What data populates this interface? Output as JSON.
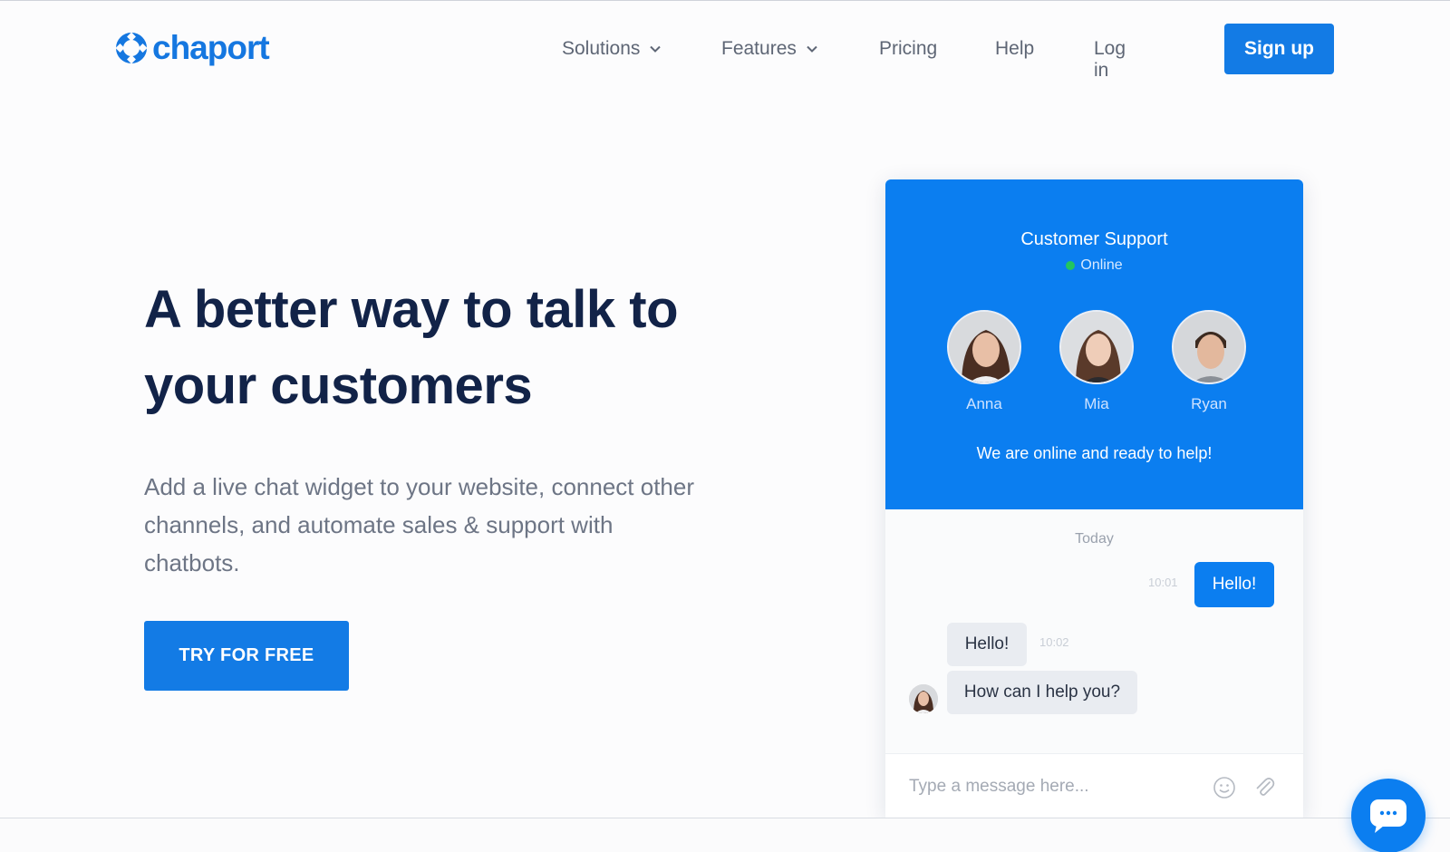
{
  "header": {
    "logo_text": "chaport",
    "nav": {
      "solutions": "Solutions",
      "features": "Features",
      "pricing": "Pricing",
      "help": "Help",
      "login": "Log in"
    },
    "signup_label": "Sign up"
  },
  "hero": {
    "title": "A better way to talk to your customers",
    "subtitle": "Add a live chat widget to your website, connect other channels, and automate sales & support with chatbots.",
    "cta_label": "TRY FOR FREE"
  },
  "widget": {
    "title": "Customer Support",
    "status": "Online",
    "agents": [
      {
        "name": "Anna"
      },
      {
        "name": "Mia"
      },
      {
        "name": "Ryan"
      }
    ],
    "tagline": "We are online and ready to help!",
    "day_label": "Today",
    "messages": [
      {
        "text": "Hello!",
        "time": "10:01",
        "from": "visitor"
      },
      {
        "text": "Hello!",
        "time": "10:02",
        "from": "agent"
      },
      {
        "text": "How can I help you?",
        "from": "agent"
      }
    ],
    "input_placeholder": "Type a message here..."
  },
  "colors": {
    "brand_blue": "#137be5",
    "widget_blue": "#0b7ef0",
    "online_green": "#23c55e",
    "heading": "#122348"
  },
  "icons": {
    "logo": "chaport-logo-icon",
    "chevron": "chevron-down-icon",
    "emoji": "smiley-icon",
    "attach": "paperclip-icon",
    "launcher": "chat-bubble-icon"
  }
}
